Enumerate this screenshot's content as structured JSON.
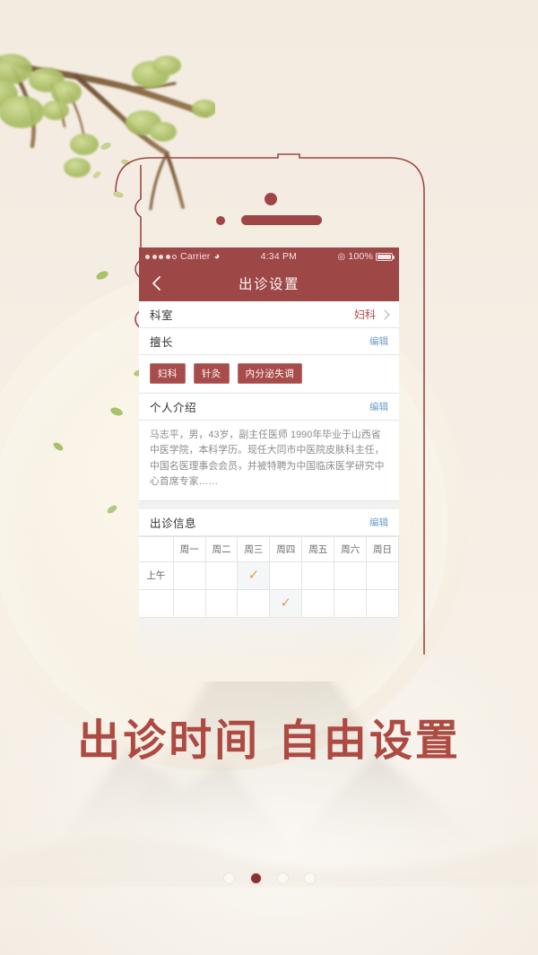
{
  "background": {
    "base_color": "#f4ece1",
    "decor_branch": "tree-branch-watercolor",
    "decor_mountain": "ink-wash-mountain"
  },
  "phone": {
    "frame_color": "#9e4646",
    "statusbar": {
      "carrier": "Carrier",
      "signal_dots_filled": 4,
      "signal_dots_total": 5,
      "wifi_icon": "wifi-icon",
      "time": "4:34 PM",
      "alarm_icon": "rotation-lock-icon",
      "battery_percent": "100%",
      "battery_icon": "battery-full-icon"
    },
    "navbar": {
      "back_icon": "chevron-left-icon",
      "title": "出诊设置"
    },
    "content": {
      "department_row": {
        "label": "科室",
        "value": "妇科",
        "chevron_icon": "chevron-right-icon"
      },
      "specialty_row": {
        "label": "擅长",
        "edit_label": "编辑"
      },
      "specialty_tags": [
        "妇科",
        "针灸",
        "内分泌失调"
      ],
      "intro_row": {
        "label": "个人介绍",
        "edit_label": "编辑"
      },
      "intro_text": "马志平，男，43岁，副主任医师  1990年毕业于山西省中医学院，本科学历。现任大同市中医院皮肤科主任，中国名医理事会会员，并被特聘为中国临床医学研究中心首席专家……",
      "schedule_row": {
        "label": "出诊信息",
        "edit_label": "编辑"
      },
      "schedule": {
        "columns": [
          "",
          "周一",
          "周二",
          "周三",
          "周四",
          "周五",
          "周六",
          "周日"
        ],
        "rows": [
          {
            "label": "上午",
            "checks": [
              false,
              false,
              true,
              false,
              false,
              false,
              false
            ]
          },
          {
            "label": "",
            "checks": [
              false,
              false,
              false,
              true,
              false,
              false,
              false
            ]
          }
        ],
        "check_icon": "check-mark-icon",
        "check_color": "#e79b4a"
      }
    }
  },
  "tagline": "出诊时间 自由设置",
  "pager": {
    "total": 4,
    "active_index": 1,
    "active_color": "#8f2f2f",
    "inactive_color": "#fbf8f2"
  }
}
